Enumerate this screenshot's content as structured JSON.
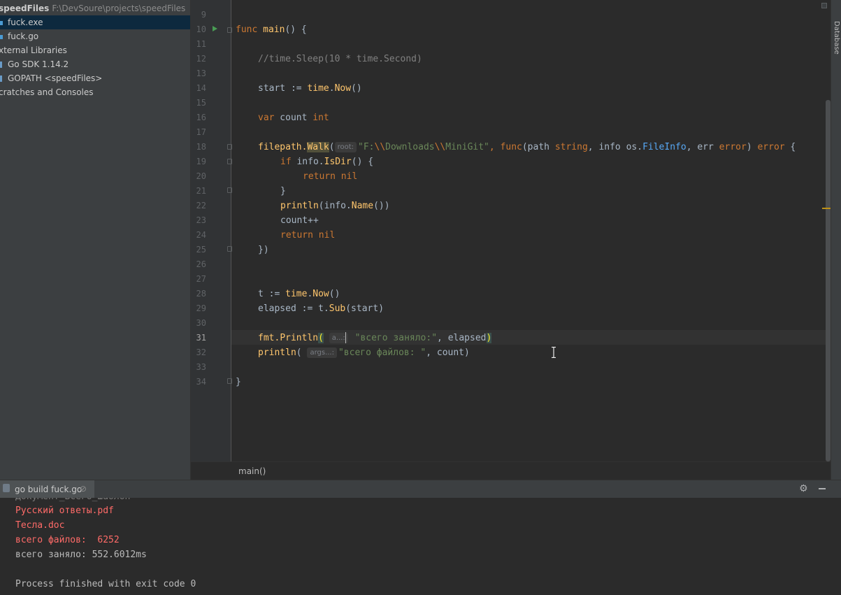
{
  "project": {
    "root_name": "speedFiles",
    "root_path": "F:\\DevSoure\\projects\\speedFiles",
    "items": [
      {
        "label": "fuck.exe",
        "selected": true
      },
      {
        "label": "fuck.go",
        "selected": false
      },
      {
        "label": "xternal Libraries",
        "selected": false
      },
      {
        "label": "Go SDK 1.14.2",
        "selected": false
      },
      {
        "label": "GOPATH <speedFiles>",
        "selected": false
      },
      {
        "label": "cratches and Consoles",
        "selected": false
      }
    ]
  },
  "editor": {
    "current_line": "31",
    "line_numbers": [
      "9",
      "10",
      "11",
      "12",
      "13",
      "14",
      "15",
      "16",
      "17",
      "18",
      "19",
      "20",
      "21",
      "22",
      "23",
      "24",
      "25",
      "26",
      "27",
      "28",
      "29",
      "30",
      "31",
      "32",
      "33",
      "34"
    ],
    "hints": {
      "root": "root:",
      "a": "a...:",
      "args": "args...:"
    },
    "tokens": {
      "func": "func",
      "main": "main",
      "main_tail": "() {",
      "comment": "//time.Sleep(10 * time.Second)",
      "start_a": "start := ",
      "time": "time",
      "now": "Now",
      "call_tail": "()",
      "var": "var",
      "count": " count ",
      "int": "int",
      "filepath": "filepath.",
      "walk": "Walk",
      "paren_open": "(",
      "str_a": "\"F:",
      "esc": "\\\\",
      "str_b": "Downloads",
      "str_c": "MiniGit\"",
      "walk_mid": ", ",
      "walk_params_a": "(path ",
      "string": "string",
      "walk_params_b": ", info os.",
      "fileinfo": "FileInfo",
      "walk_params_c": ", err ",
      "error": "error",
      "walk_params_d": ") ",
      "brace": " {",
      "if": "if",
      "if_rest": " info.",
      "isdir": "IsDir",
      "if_tail": "() {",
      "return": "return",
      "nil": " nil",
      "close_brace": "}",
      "println": "println",
      "println_args": "(info.",
      "name": "Name",
      "println_tail": "())",
      "count_inc": "count++",
      "close_walk": "})",
      "t_assign": "t := ",
      "elapsed_assign": "elapsed := t.",
      "sub": "Sub",
      "sub_tail": "(start)",
      "fmt": "fmt.",
      "Println": "Println",
      "str_taken": "\"всего заняло:\"",
      "elapsed_arg": ", elapsed",
      "paren_close": ")",
      "str_files": "\"всего файлов: \"",
      "count_arg": ", count)",
      "final_brace": "}"
    }
  },
  "breadcrumb": "main()",
  "right_toolbar": {
    "database_label": "Database"
  },
  "run_panel": {
    "tab_label": "go build fuck.go",
    "close": "⊘",
    "settings_icon": "gear-icon",
    "lines": [
      {
        "text": "Русский ответы.pdf",
        "color": "red"
      },
      {
        "text": "Тесла.doc",
        "color": "red"
      },
      {
        "text": "всего файлов:  6252",
        "color": "red"
      },
      {
        "text": "всего заняло: 552.6012ms",
        "color": "white"
      },
      {
        "text": "",
        "color": "white"
      },
      {
        "text": "Process finished with exit code 0",
        "color": "white"
      }
    ]
  }
}
